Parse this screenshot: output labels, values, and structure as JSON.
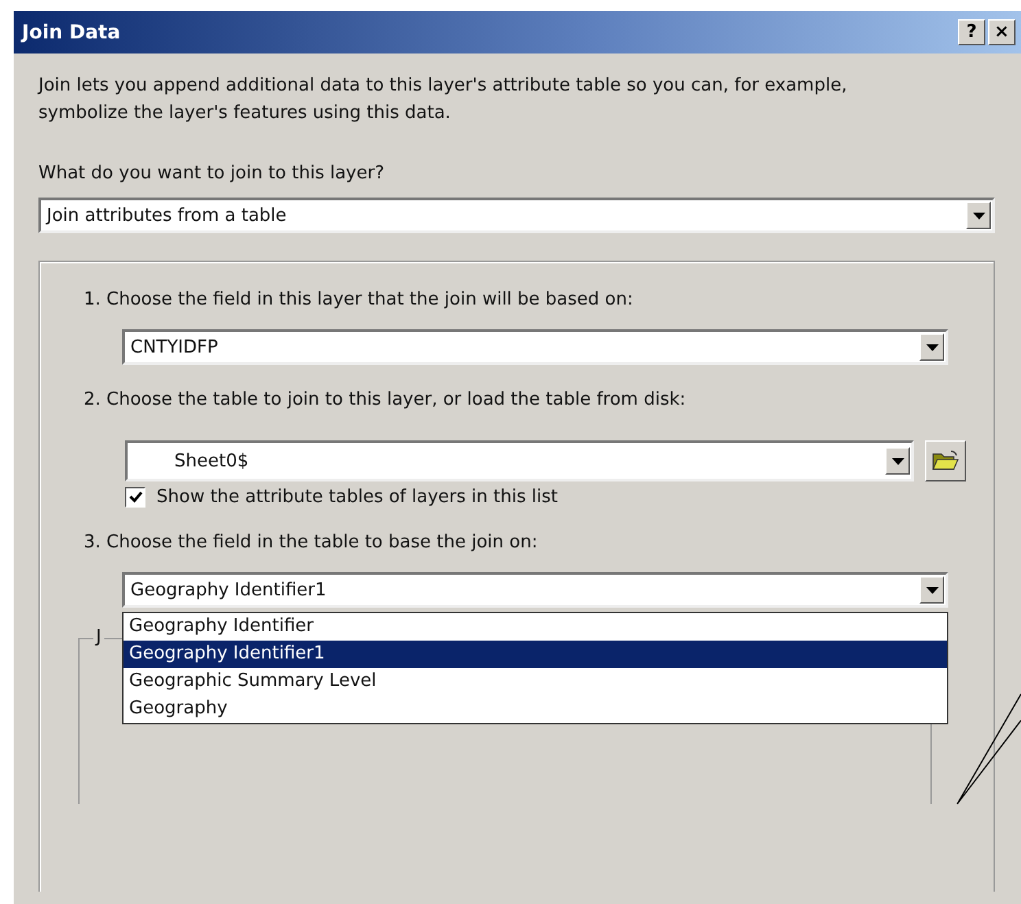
{
  "window": {
    "title": "Join Data",
    "help_button": "?",
    "close_button": "×"
  },
  "intro": "Join lets you append additional data to this layer's attribute table so you can, for example, symbolize the layer's features using this data.",
  "join_question": {
    "label": "What do you want to join to this layer?",
    "value": "Join attributes from a table"
  },
  "steps": [
    {
      "kind": "combo",
      "label": "1.  Choose the field in this layer that the join will be based on:",
      "value": "CNTYIDFP"
    },
    {
      "kind": "table",
      "label": "2.  Choose the table to join to this layer, or load the table from disk:",
      "value": "Sheet0$",
      "checkbox": {
        "label": "Show the attribute tables of layers in this list",
        "checked": true
      }
    },
    {
      "kind": "combo",
      "label": "3.  Choose the field in the table to base the join on:",
      "value": "Geography Identifier1",
      "expanded": true,
      "options": [
        {
          "label": "Geography Identifier",
          "selected": false
        },
        {
          "label": "Geography Identifier1",
          "selected": true
        },
        {
          "label": "Geographic Summary Level",
          "selected": false
        },
        {
          "label": "Geography",
          "selected": false
        }
      ]
    }
  ],
  "join_options_group": {
    "label": "J"
  }
}
